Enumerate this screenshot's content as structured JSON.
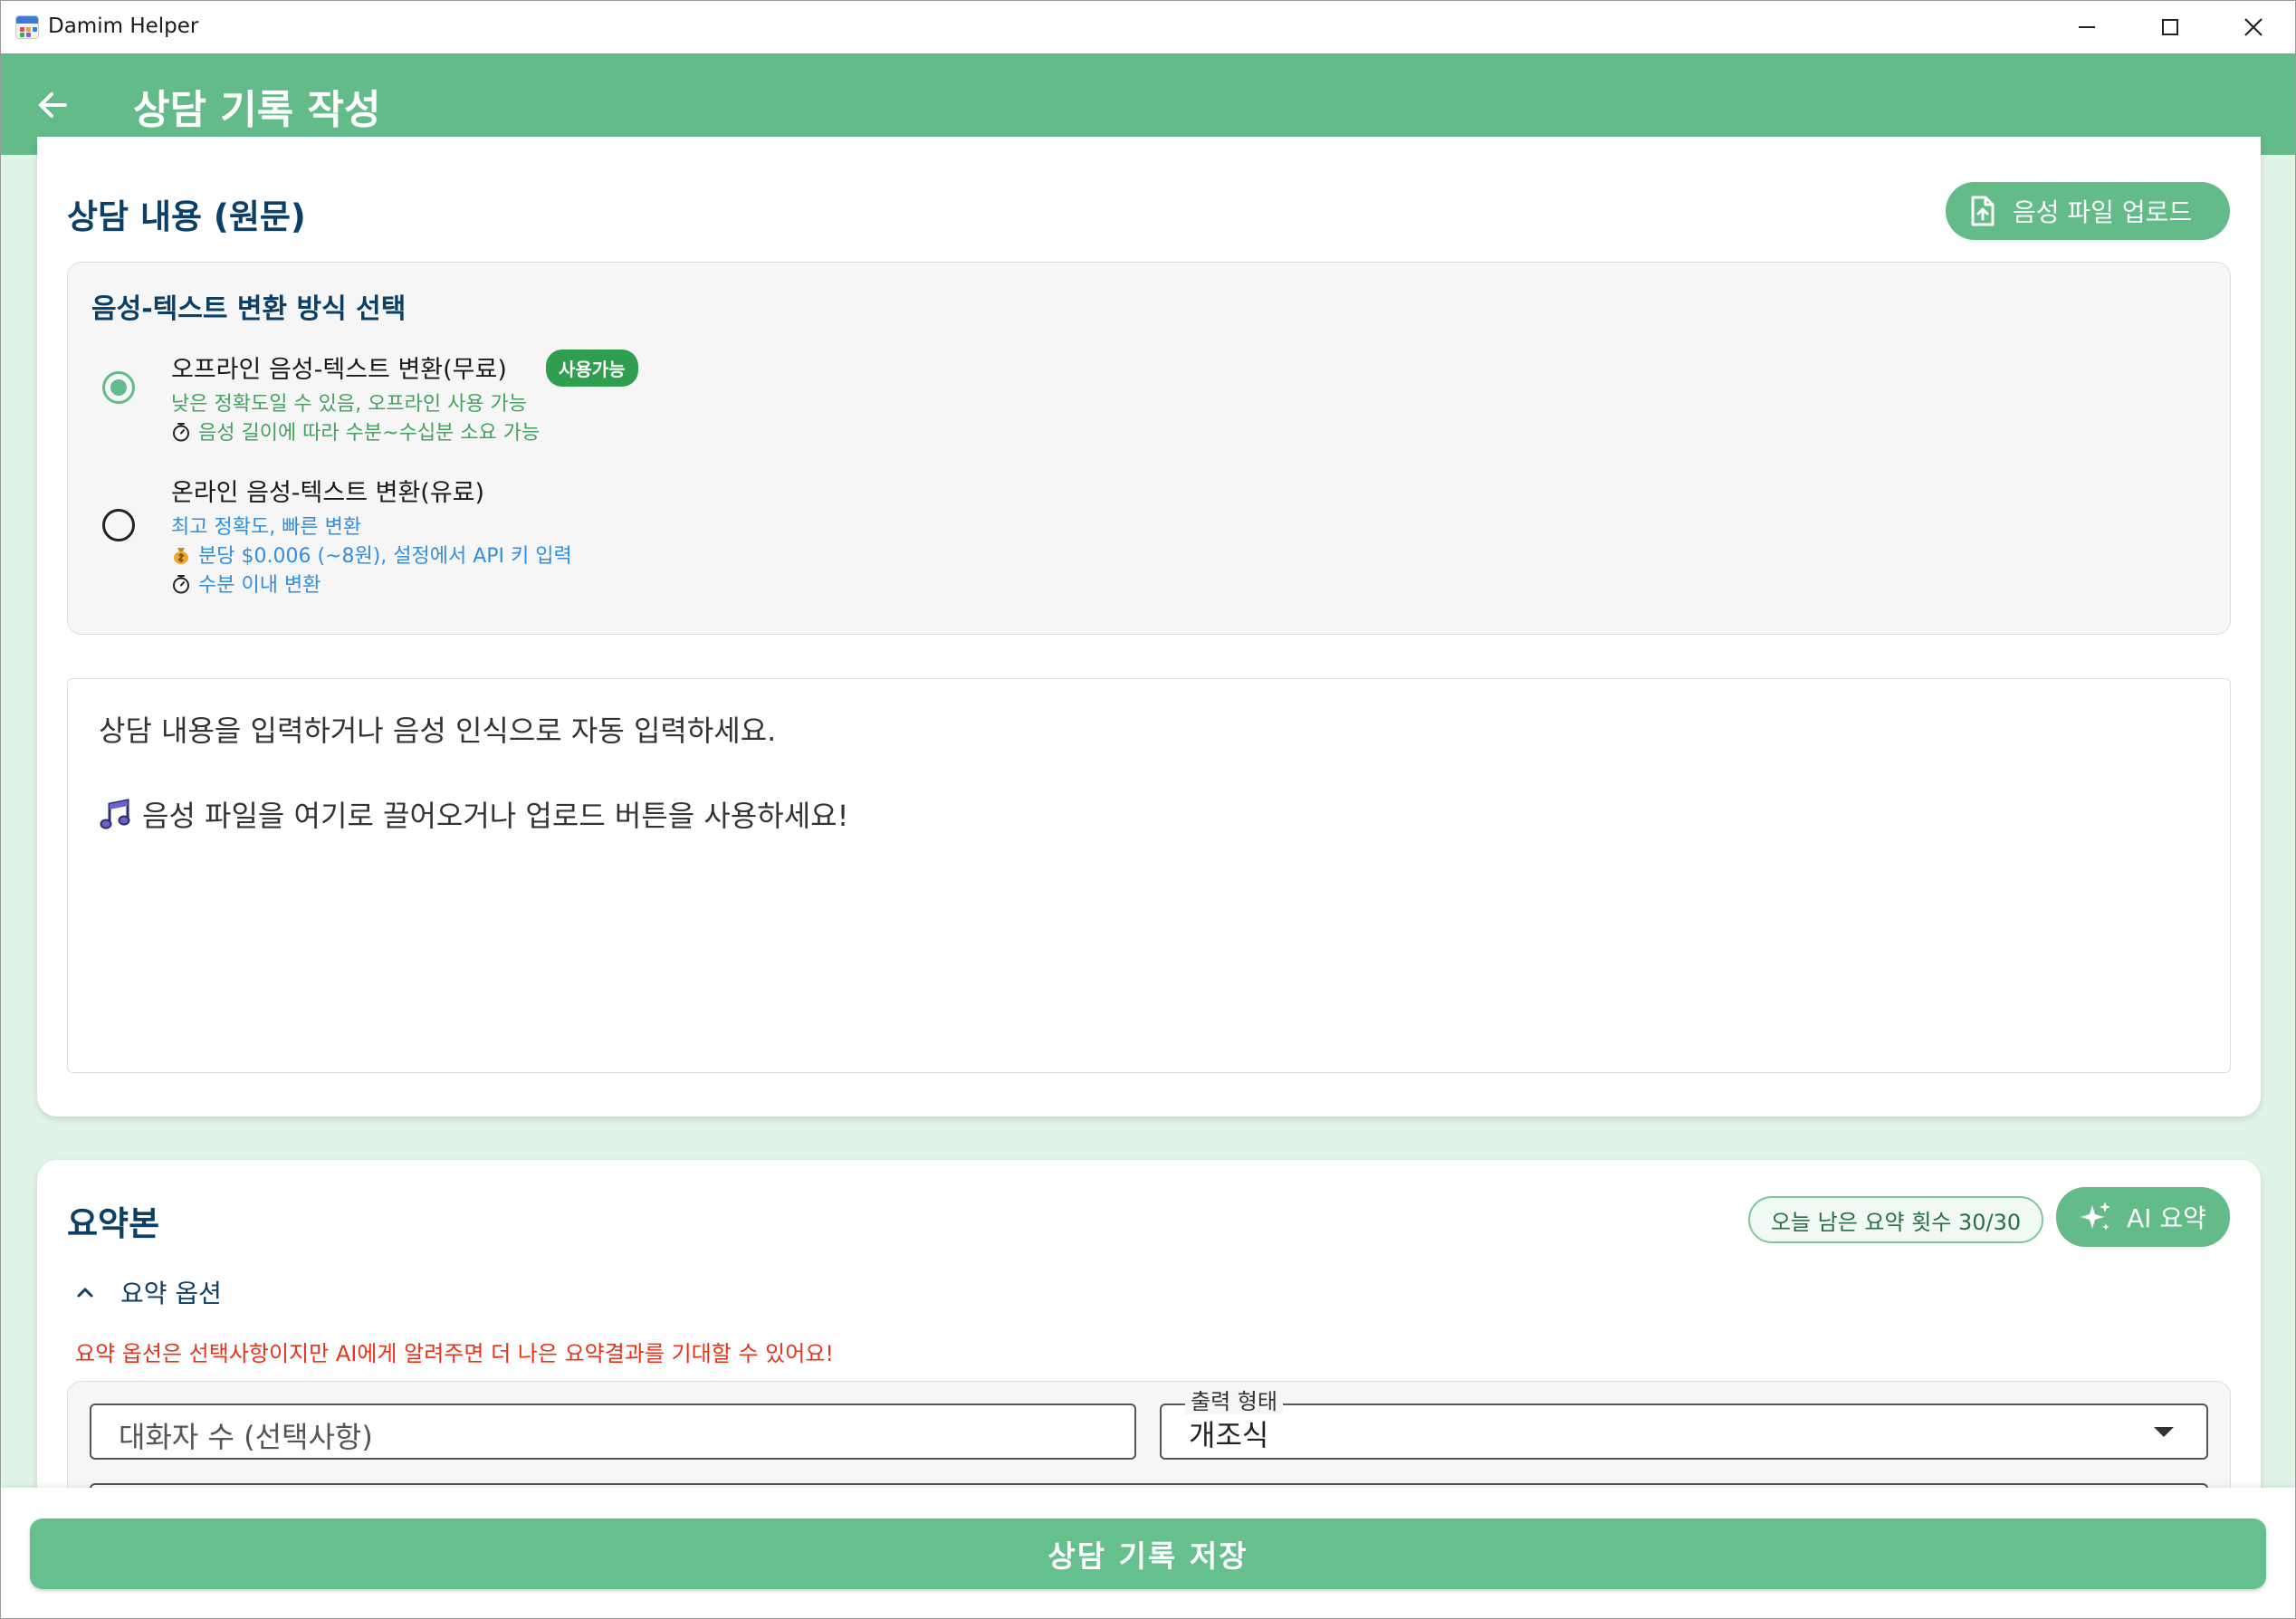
{
  "window": {
    "title": "Damim Helper"
  },
  "appbar": {
    "title": "상담 기록 작성"
  },
  "content_section": {
    "title": "상담 내용 (원문)",
    "upload_label": "음성 파일 업로드",
    "stt": {
      "title": "음성-텍스트 변환 방식 선택",
      "options": [
        {
          "title": "오프라인 음성-텍스트 변환(무료)",
          "badge": "사용가능",
          "line1": "낮은 정확도일 수 있음, 오프라인 사용 가능",
          "line2": "음성 길이에 따라 수분~수십분 소요 가능",
          "selected": true
        },
        {
          "title": "온라인 음성-텍스트 변환(유료)",
          "line1": "최고 정확도, 빠른 변환",
          "line2": "분당 $0.006 (~8원), 설정에서 API 키 입력",
          "line3": "수분 이내 변환",
          "selected": false
        }
      ]
    },
    "textarea": {
      "placeholder_line1": "상담 내용을 입력하거나 음성 인식으로 자동 입력하세요.",
      "placeholder_line2": "음성 파일을 여기로 끌어오거나 업로드 버튼을 사용하세요!"
    }
  },
  "summary_section": {
    "title": "요약본",
    "quota": "오늘 남은 요약 횟수 30/30",
    "ai_label": "AI 요약",
    "options_toggle": "요약 옵션",
    "options_note": "요약 옵션은 선택사항이지만 AI에게 알려주면 더 나은 요약결과를 기대할 수 있어요!",
    "speaker_count_placeholder": "대화자 수 (선택사항)",
    "output_format": {
      "label": "출력 형태",
      "value": "개조식"
    }
  },
  "bottom": {
    "save_label": "상담 기록 저장"
  },
  "colors": {
    "primary": "#63bb89",
    "title_text": "#0c3f66",
    "warning": "#e5341c",
    "background": "#e1f4e8"
  },
  "icons": [
    "app-calendar-icon",
    "minimize-icon",
    "maximize-icon",
    "close-icon",
    "back-arrow-icon",
    "file-upload-icon",
    "sparkle-icon",
    "chevron-up-icon",
    "dropdown-arrow-icon",
    "stopwatch-icon",
    "money-bag-icon",
    "music-note-icon"
  ]
}
